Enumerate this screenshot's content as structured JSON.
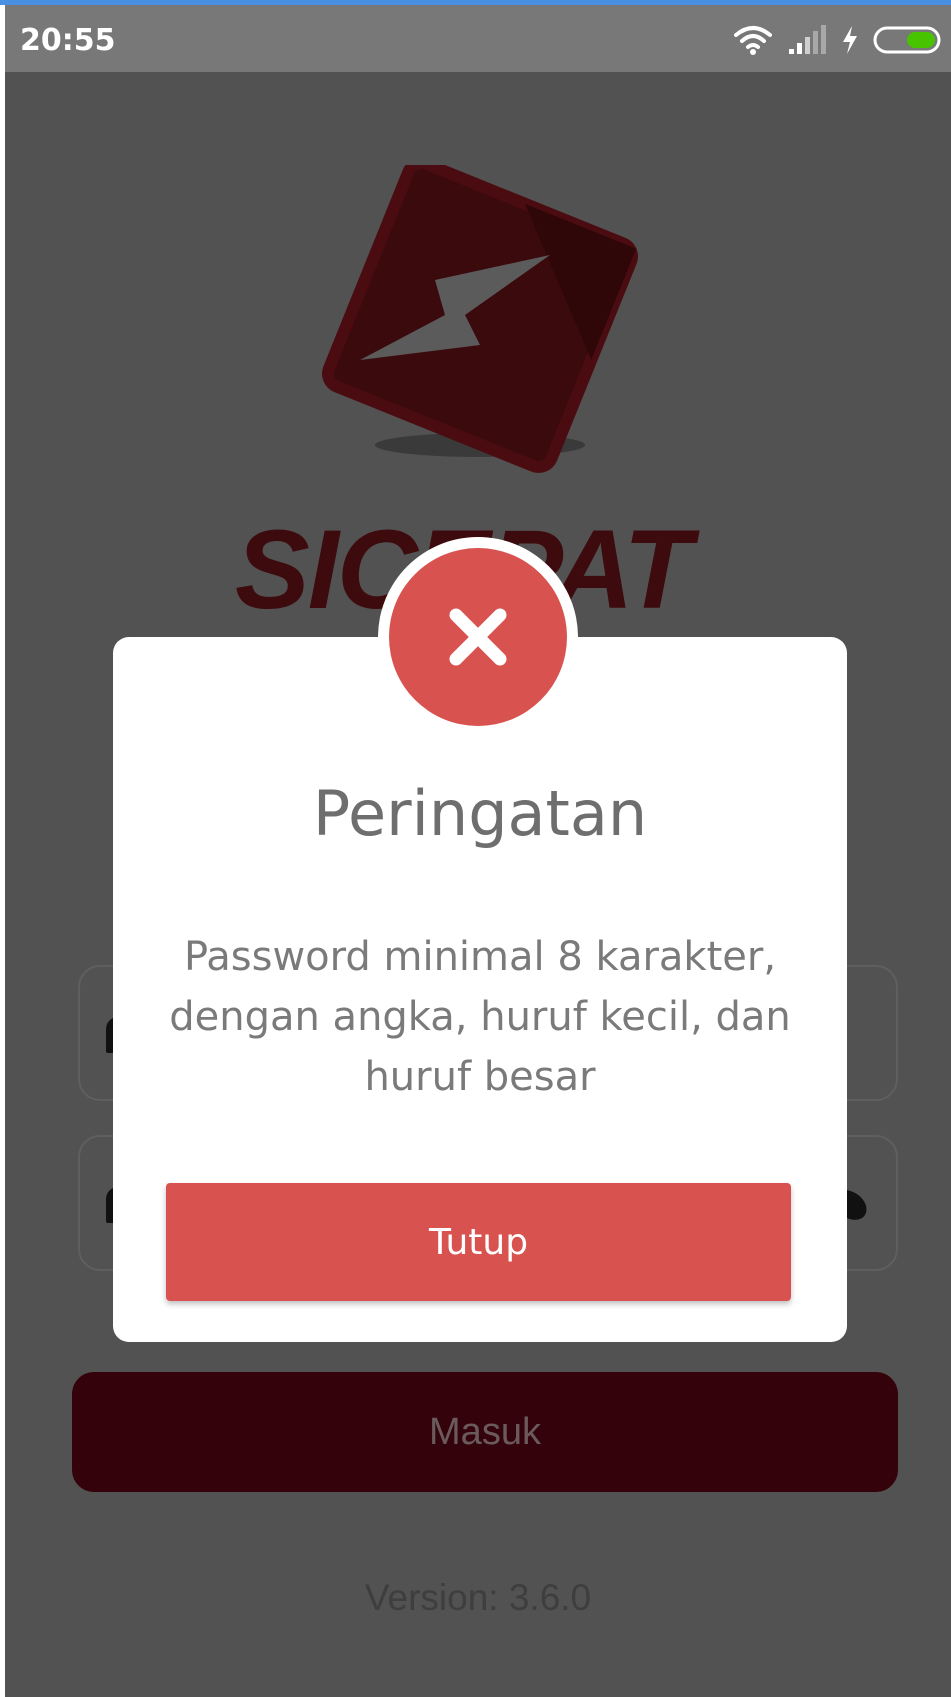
{
  "status_bar": {
    "time": "20:55",
    "icons": [
      "wifi-icon",
      "signal-icon",
      "charging-icon",
      "battery-icon"
    ],
    "battery_color": "#47c400"
  },
  "background_app": {
    "brand": "SICEPAT",
    "brand_color": "#3d0a0d",
    "login_button_label": "Masuk",
    "version_text": "Version: 3.6.0",
    "field_icons": [
      "user-icon",
      "lock-icon",
      "eye-off-icon"
    ]
  },
  "dialog": {
    "icon": "close-icon",
    "accent_color": "#d85350",
    "title": "Peringatan",
    "message": "Password minimal 8 karakter, dengan angka, huruf kecil, dan huruf besar",
    "close_button_label": "Tutup"
  }
}
